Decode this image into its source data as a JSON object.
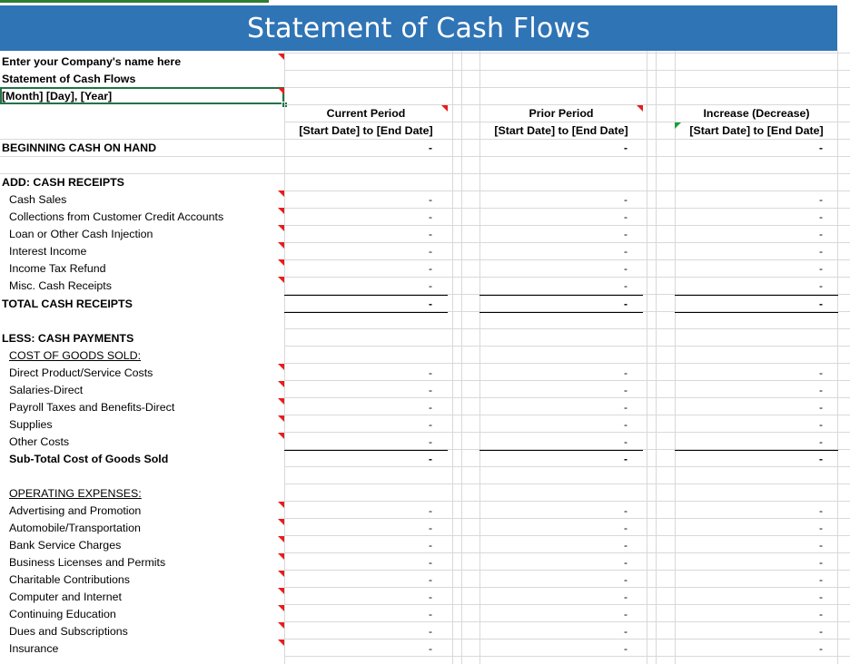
{
  "banner_title": "Statement of Cash Flows",
  "info": {
    "company": "Enter your Company's name here",
    "statement": "Statement of Cash Flows",
    "date": "[Month] [Day], [Year]"
  },
  "columns": [
    {
      "label": "Current Period",
      "range": "[Start Date] to [End Date]"
    },
    {
      "label": "Prior Period",
      "range": "[Start Date] to [End Date]"
    },
    {
      "label": "Increase (Decrease)",
      "range": "[Start Date] to [End Date]"
    }
  ],
  "rows": [
    {
      "label": "BEGINNING CASH ON HAND",
      "style": "bold",
      "values": [
        "-",
        "-",
        "-"
      ]
    },
    {
      "label": "ADD: CASH RECEIPTS",
      "style": "bold"
    },
    {
      "label": "Cash Sales",
      "indent": true,
      "values": [
        "-",
        "-",
        "-"
      ]
    },
    {
      "label": "Collections from Customer Credit Accounts",
      "indent": true,
      "values": [
        "-",
        "-",
        "-"
      ]
    },
    {
      "label": "Loan or Other Cash Injection",
      "indent": true,
      "values": [
        "-",
        "-",
        "-"
      ]
    },
    {
      "label": "Interest Income",
      "indent": true,
      "values": [
        "-",
        "-",
        "-"
      ]
    },
    {
      "label": "Income Tax Refund",
      "indent": true,
      "values": [
        "-",
        "-",
        "-"
      ]
    },
    {
      "label": "Misc. Cash Receipts",
      "indent": true,
      "values": [
        "-",
        "-",
        "-"
      ]
    },
    {
      "label": "TOTAL CASH RECEIPTS",
      "style": "bold",
      "values": [
        "-",
        "-",
        "-"
      ]
    },
    {
      "label": "LESS: CASH PAYMENTS",
      "style": "bold"
    },
    {
      "label": "COST OF GOODS SOLD:",
      "indent": true,
      "style": "underline"
    },
    {
      "label": "Direct Product/Service Costs",
      "indent": true,
      "values": [
        "-",
        "-",
        "-"
      ]
    },
    {
      "label": "Salaries-Direct",
      "indent": true,
      "values": [
        "-",
        "-",
        "-"
      ]
    },
    {
      "label": "Payroll Taxes and Benefits-Direct",
      "indent": true,
      "values": [
        "-",
        "-",
        "-"
      ]
    },
    {
      "label": "Supplies",
      "indent": true,
      "values": [
        "-",
        "-",
        "-"
      ]
    },
    {
      "label": "Other Costs",
      "indent": true,
      "values": [
        "-",
        "-",
        "-"
      ]
    },
    {
      "label": "Sub-Total Cost of Goods Sold",
      "indent": true,
      "style": "bold",
      "values": [
        "-",
        "-",
        "-"
      ]
    },
    {
      "label": "OPERATING EXPENSES:",
      "indent": true,
      "style": "underline"
    },
    {
      "label": "Advertising and Promotion",
      "indent": true,
      "values": [
        "-",
        "-",
        "-"
      ]
    },
    {
      "label": "Automobile/Transportation",
      "indent": true,
      "values": [
        "-",
        "-",
        "-"
      ]
    },
    {
      "label": "Bank Service Charges",
      "indent": true,
      "values": [
        "-",
        "-",
        "-"
      ]
    },
    {
      "label": "Business Licenses and Permits",
      "indent": true,
      "values": [
        "-",
        "-",
        "-"
      ]
    },
    {
      "label": "Charitable Contributions",
      "indent": true,
      "values": [
        "-",
        "-",
        "-"
      ]
    },
    {
      "label": "Computer and Internet",
      "indent": true,
      "values": [
        "-",
        "-",
        "-"
      ]
    },
    {
      "label": "Continuing Education",
      "indent": true,
      "values": [
        "-",
        "-",
        "-"
      ]
    },
    {
      "label": "Dues and Subscriptions",
      "indent": true,
      "values": [
        "-",
        "-",
        "-"
      ]
    },
    {
      "label": "Insurance",
      "indent": true,
      "values": [
        "-",
        "-",
        "-"
      ]
    }
  ],
  "colors": {
    "banner": "#2f74b5",
    "banner_text": "#ffffff",
    "gridline": "#d9d9d9",
    "selection": "#217346",
    "comment_marker": "#e81c1c",
    "green_marker": "#1a9e3a"
  }
}
